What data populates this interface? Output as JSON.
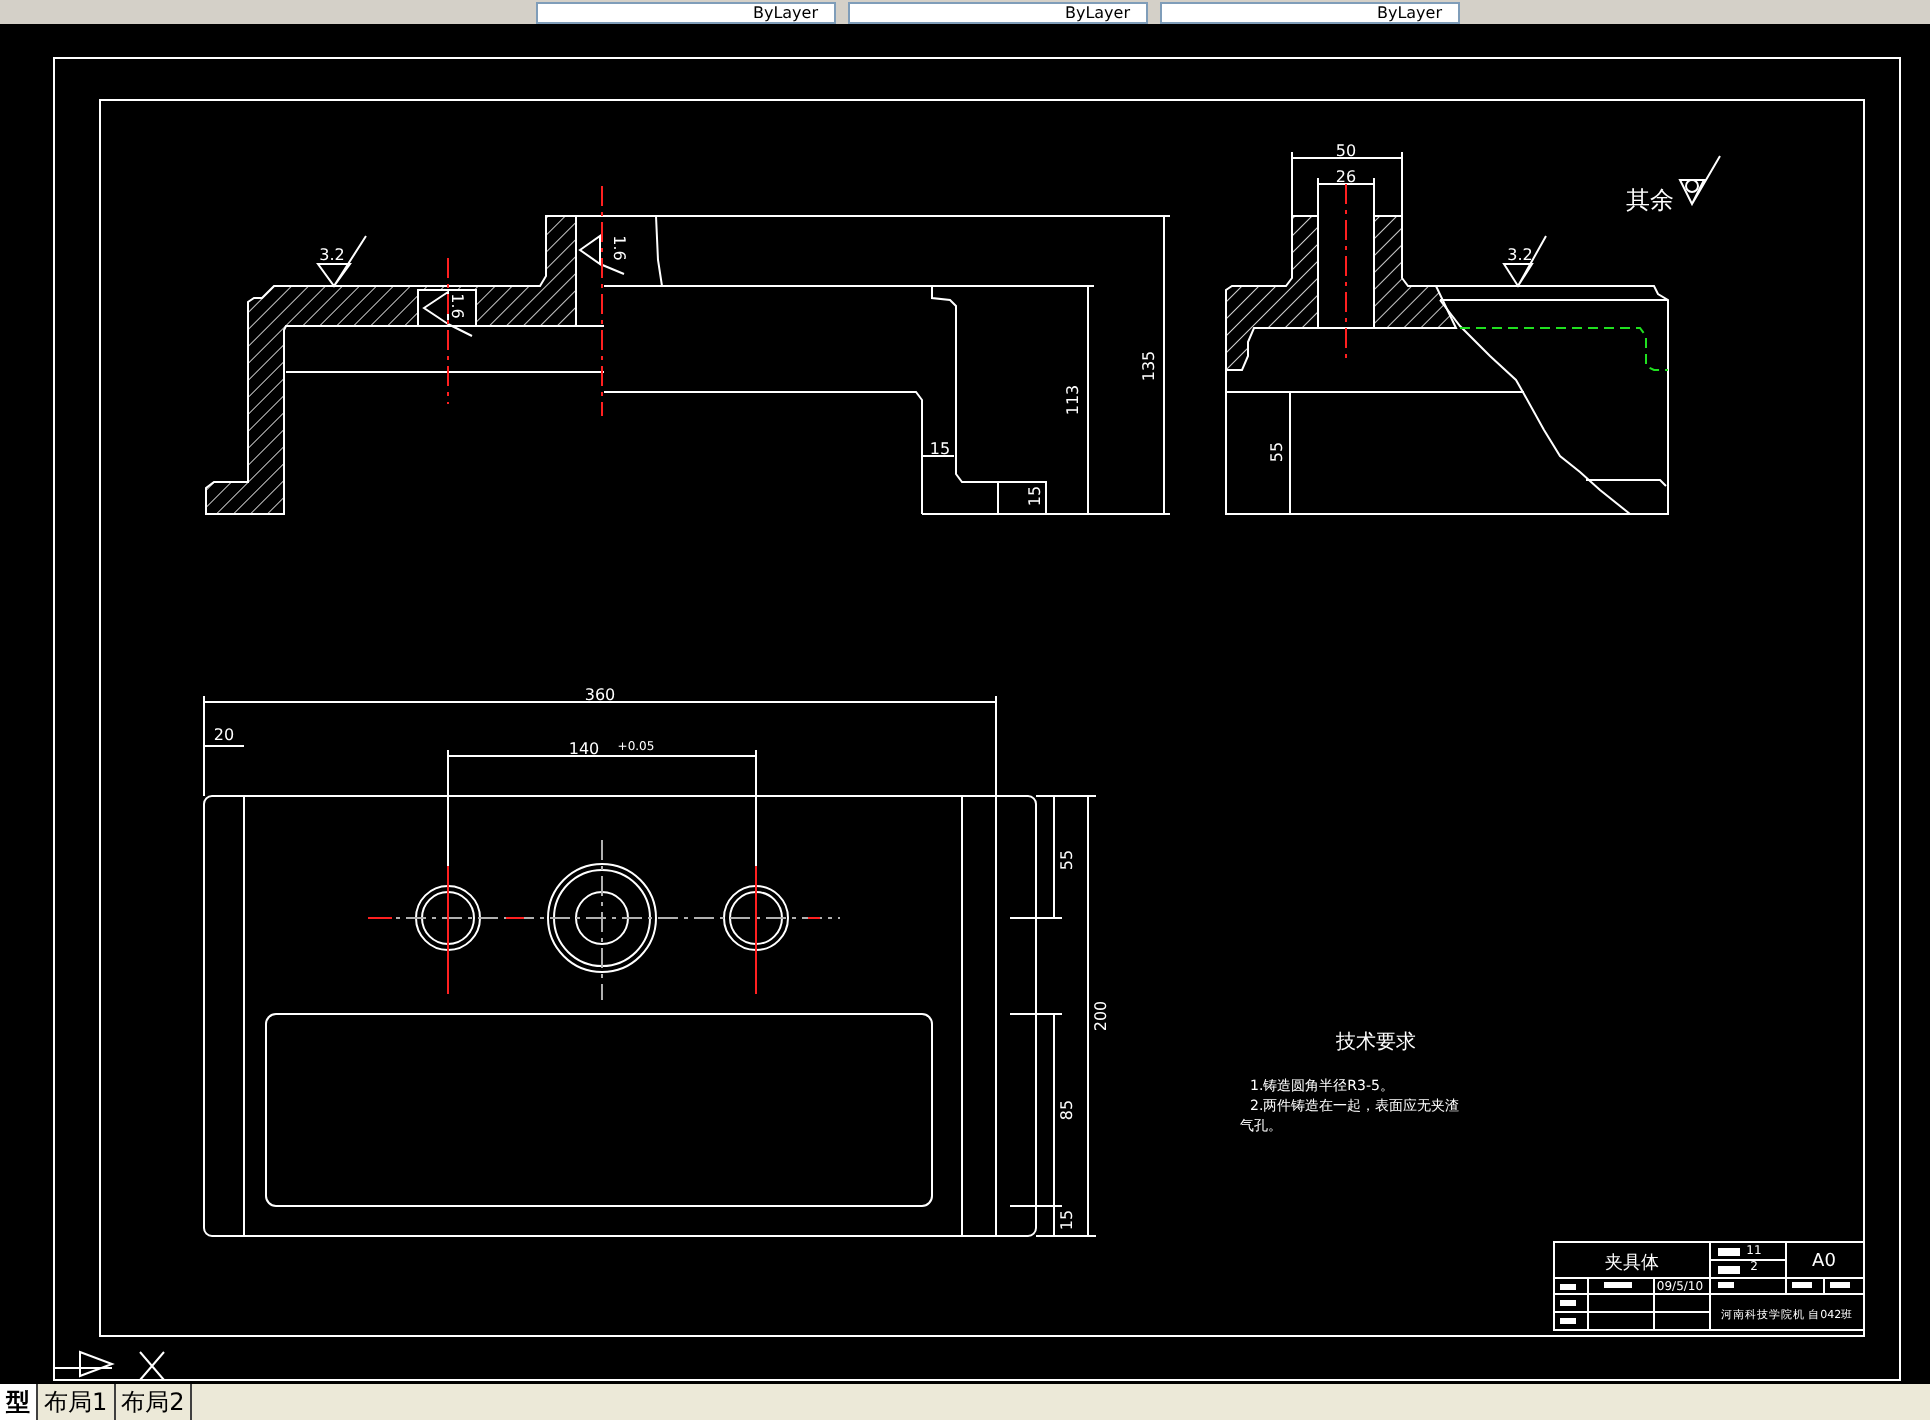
{
  "toolbar": {
    "dropdowns": [
      {
        "value": "ByLayer"
      },
      {
        "value": "ByLayer"
      },
      {
        "value": "ByLayer"
      }
    ]
  },
  "drawing": {
    "front_section": {
      "labels": [
        "3.2",
        "1.6",
        "1.6",
        "15",
        "15",
        "113",
        "135"
      ]
    },
    "side_section": {
      "labels": [
        "50",
        "26",
        "其余",
        "3.2",
        "55"
      ]
    },
    "plan_view": {
      "labels": [
        "360",
        "20",
        "140",
        "+0.05",
        "55",
        "200",
        "85",
        "15"
      ]
    },
    "technical_requirements": {
      "title": "技术要求",
      "lines": [
        "1.铸造圆角半径R3-5。",
        "2.两件铸造在一起，表面应无夹渣",
        "气孔。"
      ]
    },
    "title_block": {
      "part_name": "夹具体",
      "cells": [
        "11",
        "2",
        "A0",
        "09/5/10",
        "河南科技学院机 自042班"
      ]
    }
  },
  "layout_tabs": [
    {
      "label": "型",
      "selected": true
    },
    {
      "label": "布局1",
      "selected": false
    },
    {
      "label": "布局2",
      "selected": false
    }
  ]
}
